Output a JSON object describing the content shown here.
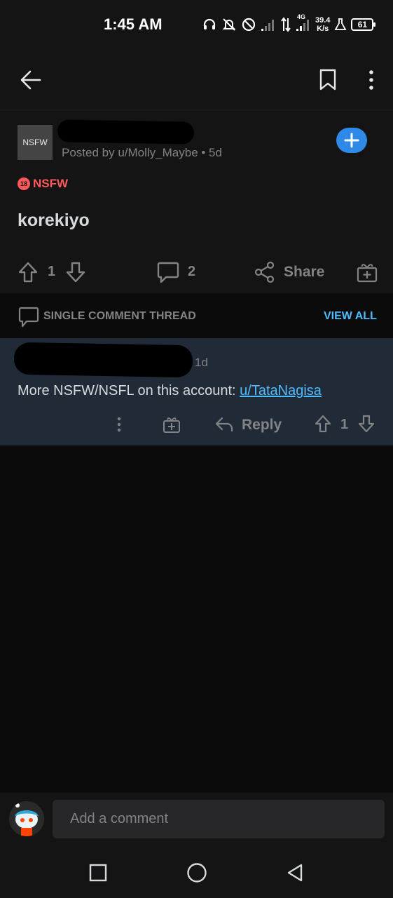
{
  "status_bar": {
    "time": "1:45 AM",
    "network_type": "4G",
    "net_speed_value": "39.4",
    "net_speed_unit": "K/s",
    "battery": "61",
    "icons": [
      "headset-icon",
      "bell-off-icon",
      "do-not-disturb-icon",
      "signal-icon",
      "data-arrows-icon",
      "signal-4g-icon",
      "flask-icon",
      "battery-icon"
    ]
  },
  "nav": {
    "back_icon": "back-arrow-icon",
    "bookmark_icon": "bookmark-icon",
    "more_icon": "more-vertical-icon"
  },
  "post": {
    "subreddit_thumbnail_text": "NSFW",
    "meta": "Posted by u/Molly_Maybe • 5d",
    "nsfw_badge": "18",
    "nsfw_label": "NSFW",
    "title": "korekiyo",
    "vote_count": "1",
    "comment_count": "2",
    "share_label": "Share"
  },
  "thread": {
    "label": "SINGLE COMMENT THREAD",
    "view_all": "VIEW ALL"
  },
  "comment": {
    "age": "1d",
    "body_text": "More NSFW/NSFL on this account: ",
    "link_text": "u/TataNagisa",
    "reply_label": "Reply",
    "vote_count": "1"
  },
  "comment_bar": {
    "placeholder": "Add a comment"
  },
  "colors": {
    "accent_blue": "#2e8ae6",
    "link_blue": "#4fbcff",
    "nsfw_red": "#ff585b",
    "comment_bg": "#212b38",
    "muted_text": "#818384"
  }
}
